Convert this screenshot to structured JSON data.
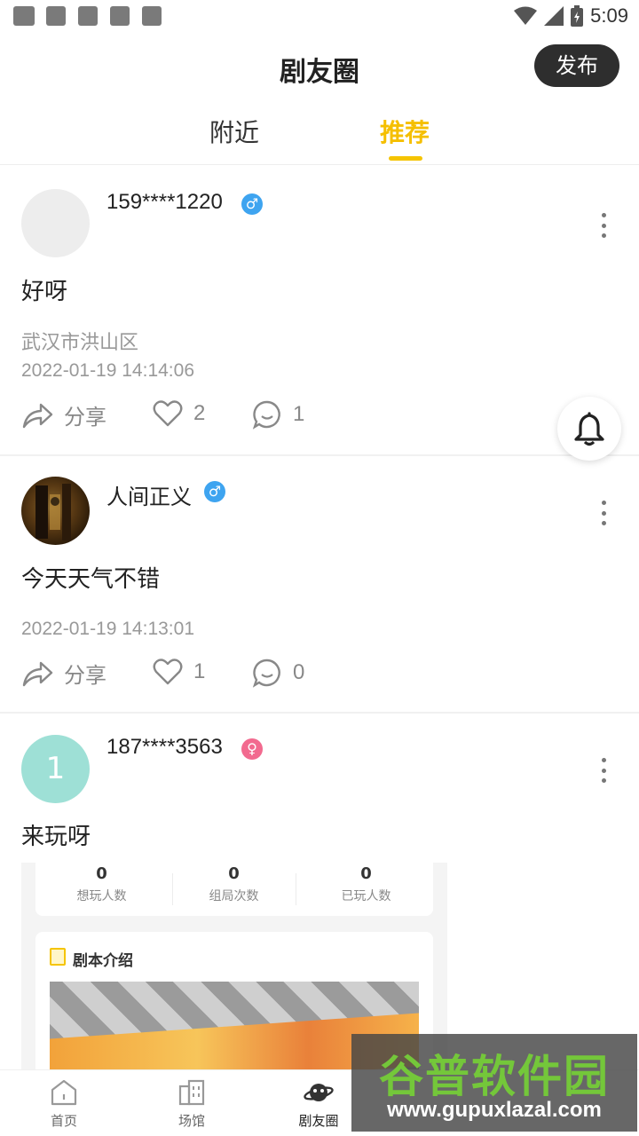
{
  "status_bar": {
    "time": "5:09",
    "icons": [
      "notification-icon",
      "notification-icon",
      "image-icon",
      "notification-icon",
      "a-icon",
      "wifi-icon",
      "signal-icon",
      "battery-icon"
    ]
  },
  "header": {
    "title": "剧友圈",
    "publish_label": "发布"
  },
  "tabs": [
    {
      "label": "附近",
      "active": false
    },
    {
      "label": "推荐",
      "active": true
    }
  ],
  "posts": [
    {
      "username": "159****1220",
      "gender": "male",
      "content": "好呀",
      "location": "武汉市洪山区",
      "timestamp": "2022-01-19 14:14:06",
      "share_label": "分享",
      "likes": "2",
      "comments": "1"
    },
    {
      "username": "人间正义",
      "gender": "male",
      "content": "今天天气不错",
      "timestamp": "2022-01-19 14:13:01",
      "share_label": "分享",
      "likes": "1",
      "comments": "0"
    },
    {
      "username": "187****3563",
      "gender": "female",
      "avatar_letter": "1",
      "content": "来玩呀"
    }
  ],
  "embed": {
    "stats": [
      {
        "value": "0",
        "label": "想玩人数"
      },
      {
        "value": "0",
        "label": "组局次数"
      },
      {
        "value": "0",
        "label": "已玩人数"
      }
    ],
    "intro_title": "剧本介绍"
  },
  "bottom_nav": [
    {
      "label": "首页",
      "active": false
    },
    {
      "label": "场馆",
      "active": false
    },
    {
      "label": "剧友圈",
      "active": true
    }
  ],
  "watermark": {
    "text": "谷普软件园",
    "url": "www.gupuxlazal.com"
  },
  "colors": {
    "accent": "#f5c400",
    "male": "#3ea4f0",
    "female": "#f26a8f"
  }
}
